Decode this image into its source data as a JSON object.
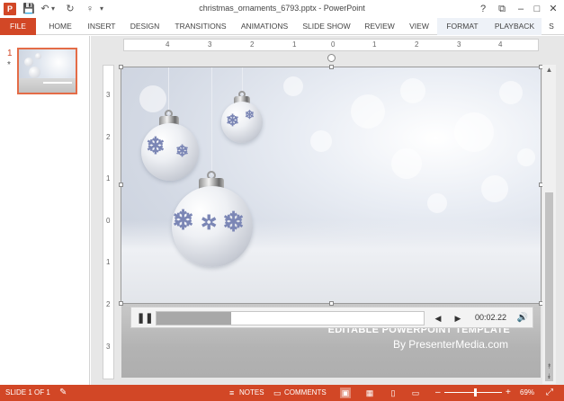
{
  "window": {
    "title": "christmas_ornaments_6793.pptx - PowerPoint",
    "app_icon": "P",
    "help": "?",
    "minimize": "–",
    "restore": "□",
    "close": "✕",
    "ribbon_display": "⧉"
  },
  "quick_access": {
    "save_icon": "💾",
    "undo_icon": "↶",
    "undo_dropdown": "▾",
    "redo_icon": "↻",
    "presenter_icon": "♀",
    "customize_icon": "▾"
  },
  "ribbon": {
    "tabs": [
      "FILE",
      "HOME",
      "INSERT",
      "DESIGN",
      "TRANSITIONS",
      "ANIMATIONS",
      "SLIDE SHOW",
      "REVIEW",
      "VIEW",
      "FORMAT",
      "PLAYBACK",
      "S"
    ]
  },
  "thumbnails": {
    "slide_number": "1",
    "star": "*"
  },
  "ruler": {
    "horizontal": [
      "4",
      "3",
      "2",
      "1",
      "0",
      "1",
      "2",
      "3",
      "4"
    ],
    "vertical": [
      "3",
      "2",
      "1",
      "0",
      "1",
      "2",
      "3"
    ]
  },
  "slide": {
    "title": "EDITABLE POWERPOINT TEMPLATE",
    "subtitle": "By PresenterMedia.com"
  },
  "media": {
    "pause_icon": "❚❚",
    "back_icon": "◀",
    "forward_icon": "▶",
    "time": "00:02.22",
    "volume_icon": "🔊",
    "progress": 0.28
  },
  "scrollbar": {
    "up": "▲",
    "down": "▼",
    "prev_slide": "⯭",
    "next_slide": "⯯"
  },
  "statusbar": {
    "slide_indicator": "SLIDE 1 OF 1",
    "notes_label": "NOTES",
    "comments_label": "COMMENTS",
    "zoom_minus": "–",
    "zoom_plus": "+",
    "zoom_level": "69%",
    "fit_icon": "⤢"
  },
  "colors": {
    "accent": "#d24726"
  }
}
